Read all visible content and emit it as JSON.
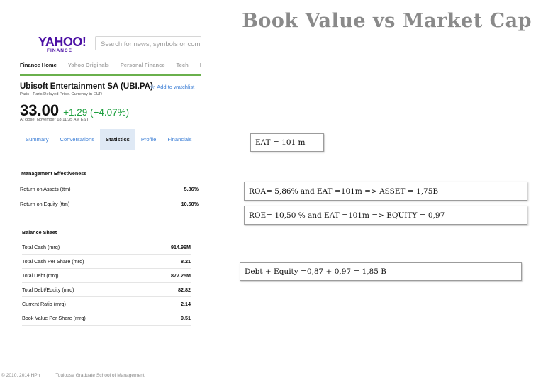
{
  "slide": {
    "title": "Book Value vs Market Cap",
    "footer_copyright": "© 2010, 2014 HPh",
    "footer_school": "Toulouse Graduate School of Management"
  },
  "yahoo": {
    "logo_main": "YAHOO!",
    "logo_sub": "FINANCE",
    "search_placeholder": "Search for news, symbols or compani",
    "nav": [
      "Finance Home",
      "Yahoo Originals",
      "Personal Finance",
      "Tech",
      "M"
    ],
    "company": "Ubisoft Entertainment SA (UBI.PA)",
    "watchlist": "Add to watchlist",
    "exchange": "Paris - Paris Delayed Price. Currency in EUR",
    "price": "33.00",
    "change": "+1.29 (+4.07%)",
    "close_time": "At close: November 18 11:35 AM EST",
    "tabs": [
      "Summary",
      "Conversations",
      "Statistics",
      "Profile",
      "Financials"
    ],
    "mgmt_title": "Management Effectiveness",
    "mgmt_rows": [
      {
        "label": "Return on Assets (ttm)",
        "value": "5.86%"
      },
      {
        "label": "Return on Equity (ttm)",
        "value": "10.50%"
      }
    ],
    "bs_title": "Balance Sheet",
    "bs_rows": [
      {
        "label": "Total Cash (mrq)",
        "value": "914.96M"
      },
      {
        "label": "Total Cash Per Share (mrq)",
        "value": "8.21"
      },
      {
        "label": "Total Debt (mrq)",
        "value": "877.25M"
      },
      {
        "label": "Total Debt/Equity (mrq)",
        "value": "82.82"
      },
      {
        "label": "Current Ratio (mrq)",
        "value": "2.14"
      },
      {
        "label": "Book Value Per Share (mrq)",
        "value": "9.51"
      }
    ]
  },
  "notes": {
    "eat": "EAT =  101 m",
    "roa": "ROA= 5,86% and EAT =101m  => ASSET = 1,75B",
    "roe": "ROE= 10,50 % and EAT =101m  => EQUITY = 0,97",
    "debt_equity": "Debt + Equity =0,87 + 0,97 = 1,85 B"
  },
  "colors": {
    "title_gray": "#8a8a8a",
    "yahoo_purple": "#4b0fa4",
    "positive_green": "#1d9f3e",
    "link_blue": "#3d7fd6",
    "active_tab_bg": "#dfe9f5"
  }
}
